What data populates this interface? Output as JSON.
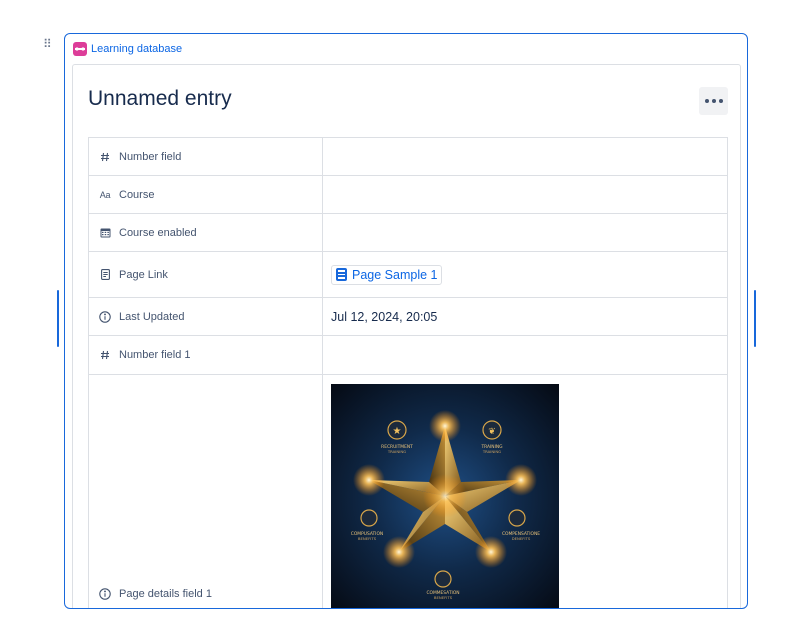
{
  "database": {
    "name": "Learning database",
    "icon": "database-icon",
    "accent": "#dd3d99"
  },
  "entry": {
    "title": "Unnamed entry",
    "more_icon": "more-actions-icon"
  },
  "fields": [
    {
      "icon": "number-icon",
      "icon_text": "",
      "name": "Number field",
      "value": ""
    },
    {
      "icon": "text-icon",
      "icon_text": "Aa",
      "name": "Course",
      "value": ""
    },
    {
      "icon": "calendar-icon",
      "icon_text": "",
      "name": "Course enabled",
      "value": ""
    },
    {
      "icon": "page-icon",
      "icon_text": "",
      "name": "Page Link",
      "value": "Page Sample 1"
    },
    {
      "icon": "info-icon",
      "icon_text": "",
      "name": "Last Updated",
      "value": "Jul 12, 2024, 20:05"
    },
    {
      "icon": "number-icon",
      "icon_text": "",
      "name": "Number field 1",
      "value": ""
    },
    {
      "icon": "info-icon",
      "icon_text": "",
      "name": "Page details field 1",
      "value": ""
    }
  ],
  "image": {
    "labels": {
      "top_left": "RECRUITMENT",
      "top_left_sub": "TRAINING",
      "top_right": "TRAINING",
      "top_right_sub": "TRAINING",
      "mid_left": "COMPUSATION",
      "mid_left_sub": "BENEFITS",
      "mid_right": "COMPENSATIONE",
      "mid_right_sub": "DENEFITS",
      "bottom": "COMMESATION",
      "bottom_sub": "BENEFITS"
    }
  },
  "colors": {
    "accent": "#1868db",
    "link": "#0c66e4",
    "border": "#dcdfe4"
  }
}
